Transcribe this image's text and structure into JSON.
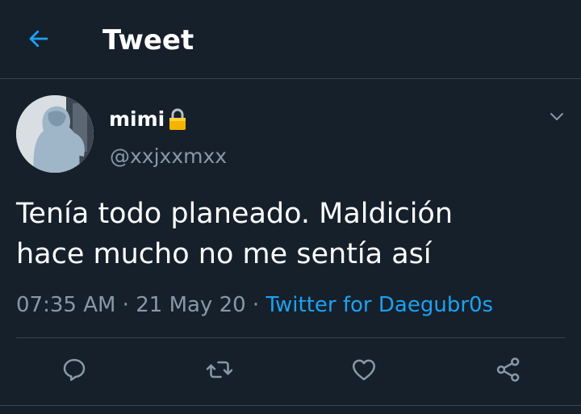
{
  "header": {
    "title": "Tweet",
    "back_icon": "arrow-left-icon"
  },
  "tweet": {
    "display_name": "mimi",
    "lock_icon": "lock-icon",
    "handle": "@xxjxxmxx",
    "text_line1": "Tenía todo planeado. Maldición",
    "text_line2": "hace mucho no me sentía así",
    "time": "07:35 AM",
    "separator": " · ",
    "date": "21 May 20",
    "source": "Twitter for Daegubr0s"
  },
  "actions": [
    "reply-icon",
    "retweet-icon",
    "like-icon",
    "share-icon"
  ],
  "colors": {
    "background": "#15202b",
    "accent": "#1da1f2",
    "secondary_text": "#8899a6",
    "divider": "#38444d"
  }
}
